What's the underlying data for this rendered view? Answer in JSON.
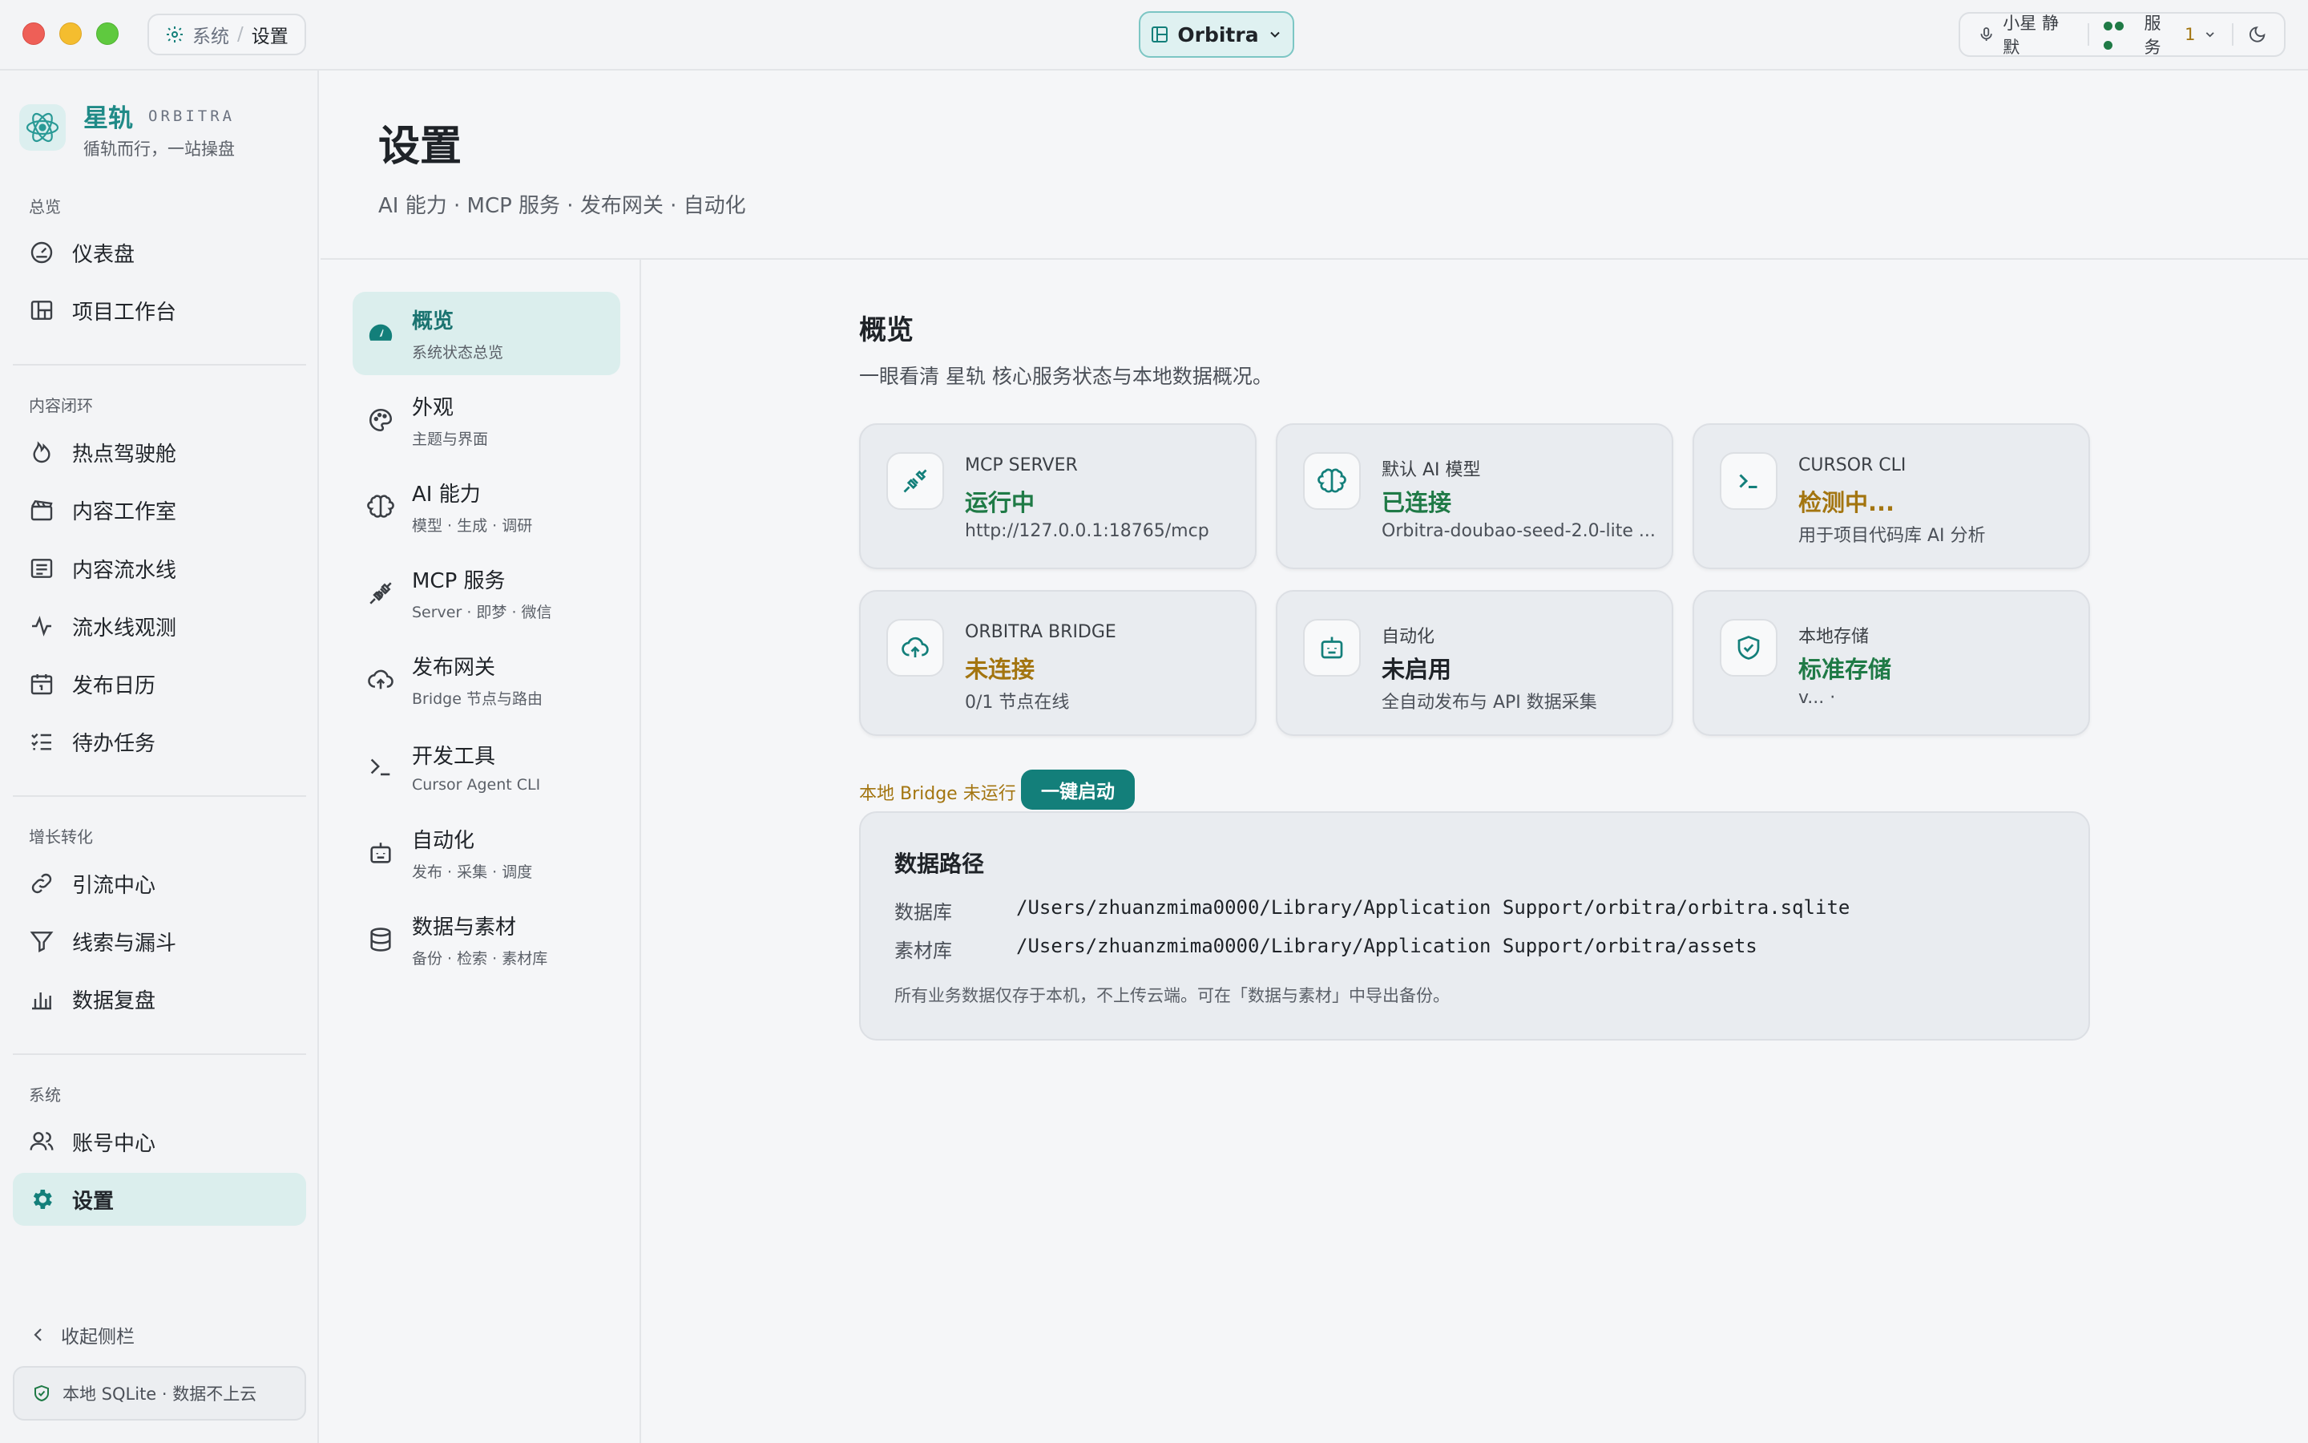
{
  "titlebar": {
    "breadcrumb": [
      "系统",
      "/",
      "设置"
    ],
    "app_name": "Orbitra",
    "voice_label": "小星 静默",
    "services_label": "服务",
    "services_count": "1"
  },
  "brand": {
    "name": "星轨",
    "name_en": "ORBITRA",
    "tagline": "循轨而行，一站操盘"
  },
  "sidebar": {
    "sections": [
      {
        "label": "总览",
        "items": [
          {
            "label": "仪表盘",
            "icon": "gauge-icon"
          },
          {
            "label": "项目工作台",
            "icon": "grid-icon"
          }
        ]
      },
      {
        "label": "内容闭环",
        "items": [
          {
            "label": "热点驾驶舱",
            "icon": "flame-icon"
          },
          {
            "label": "内容工作室",
            "icon": "clapperboard-icon"
          },
          {
            "label": "内容流水线",
            "icon": "list-icon"
          },
          {
            "label": "流水线观测",
            "icon": "activity-icon"
          },
          {
            "label": "发布日历",
            "icon": "calendar-icon"
          },
          {
            "label": "待办任务",
            "icon": "checklist-icon"
          }
        ]
      },
      {
        "label": "增长转化",
        "items": [
          {
            "label": "引流中心",
            "icon": "link-icon"
          },
          {
            "label": "线索与漏斗",
            "icon": "funnel-icon"
          },
          {
            "label": "数据复盘",
            "icon": "bar-chart-icon"
          }
        ]
      },
      {
        "label": "系统",
        "items": [
          {
            "label": "账号中心",
            "icon": "users-icon"
          },
          {
            "label": "设置",
            "icon": "gear-icon"
          }
        ]
      }
    ],
    "collapse_label": "收起侧栏",
    "local_note": "本地 SQLite · 数据不上云"
  },
  "page": {
    "title": "设置",
    "subtitle": "AI 能力 · MCP 服务 · 发布网关 · 自动化"
  },
  "subnav": [
    {
      "title": "概览",
      "desc": "系统状态总览",
      "icon": "dashboard-icon"
    },
    {
      "title": "外观",
      "desc": "主题与界面",
      "icon": "palette-icon"
    },
    {
      "title": "AI 能力",
      "desc": "模型 · 生成 · 调研",
      "icon": "brain-icon"
    },
    {
      "title": "MCP 服务",
      "desc": "Server · 即梦 · 微信",
      "icon": "plug-icon"
    },
    {
      "title": "发布网关",
      "desc": "Bridge 节点与路由",
      "icon": "cloud-upload-icon"
    },
    {
      "title": "开发工具",
      "desc": "Cursor Agent CLI",
      "icon": "terminal-icon"
    },
    {
      "title": "自动化",
      "desc": "发布 · 采集 · 调度",
      "icon": "bot-icon"
    },
    {
      "title": "数据与素材",
      "desc": "备份 · 检索 · 素材库",
      "icon": "database-icon"
    }
  ],
  "overview": {
    "title": "概览",
    "desc": "一眼看清 星轨 核心服务状态与本地数据概况。",
    "cards": [
      {
        "label": "MCP SERVER",
        "value": "运行中",
        "detail": "http://127.0.0.1:18765/mcp",
        "color": "#1f7a46",
        "icon": "plug-icon"
      },
      {
        "label": "默认 AI 模型",
        "value": "已连接",
        "detail": "Orbitra-doubao-seed-2.0-lite ...",
        "color": "#1f7a46",
        "icon": "brain-icon"
      },
      {
        "label": "CURSOR CLI",
        "value": "检测中...",
        "detail": "用于项目代码库 AI 分析",
        "color": "#a37510",
        "icon": "terminal-icon"
      },
      {
        "label": "ORBITRA BRIDGE",
        "value": "未连接",
        "detail": "0/1 节点在线",
        "color": "#a37510",
        "icon": "cloud-upload-icon"
      },
      {
        "label": "自动化",
        "value": "未启用",
        "detail": "全自动发布与 API 数据采集",
        "color": "#1f2328",
        "icon": "bot-icon"
      },
      {
        "label": "本地存储",
        "value": "标准存储",
        "detail": "v... ·",
        "color": "#1f7a46",
        "icon": "shield-icon"
      }
    ],
    "bridge_note": "本地 Bridge 未运行",
    "bridge_button": "一键启动"
  },
  "paths": {
    "title": "数据路径",
    "rows": [
      {
        "label": "数据库",
        "value": "/Users/zhuanzmima0000/Library/Application Support/orbitra/orbitra.sqlite"
      },
      {
        "label": "素材库",
        "value": "/Users/zhuanzmima0000/Library/Application Support/orbitra/assets"
      }
    ],
    "note": "所有业务数据仅存于本机，不上传云端。可在「数据与素材」中导出备份。"
  },
  "colors": {
    "accent": "#137f7a",
    "success": "#1f7a46",
    "warning": "#a37510",
    "active_bg": "#dbeeed"
  }
}
